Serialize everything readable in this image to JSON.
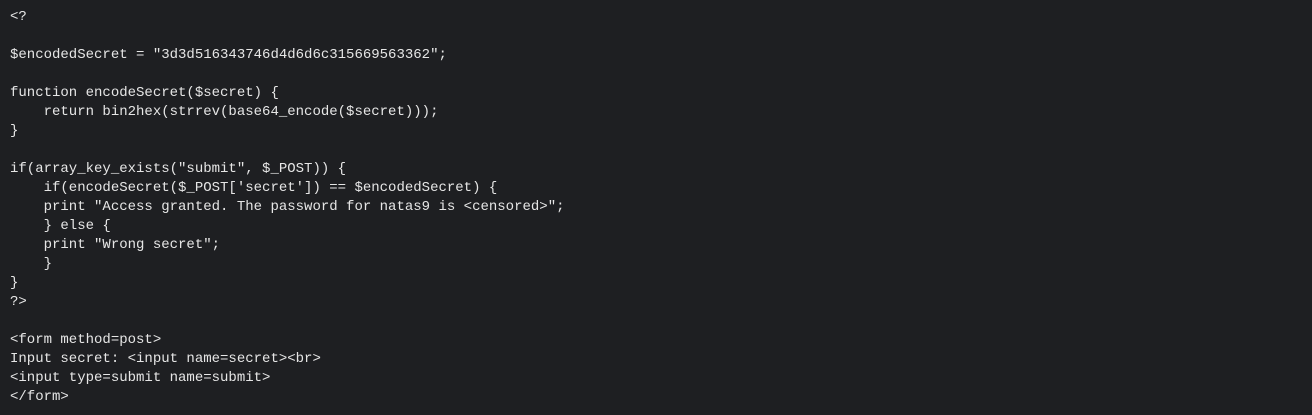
{
  "source_code": {
    "lines": [
      "<?",
      "",
      "$encodedSecret = \"3d3d516343746d4d6d6c315669563362\";",
      "",
      "function encodeSecret($secret) {",
      "    return bin2hex(strrev(base64_encode($secret)));",
      "}",
      "",
      "if(array_key_exists(\"submit\", $_POST)) {",
      "    if(encodeSecret($_POST['secret']) == $encodedSecret) {",
      "    print \"Access granted. The password for natas9 is <censored>\";",
      "    } else {",
      "    print \"Wrong secret\";",
      "    }",
      "}",
      "?>",
      "",
      "<form method=post>",
      "Input secret: <input name=secret><br>",
      "<input type=submit name=submit>",
      "</form>"
    ]
  }
}
